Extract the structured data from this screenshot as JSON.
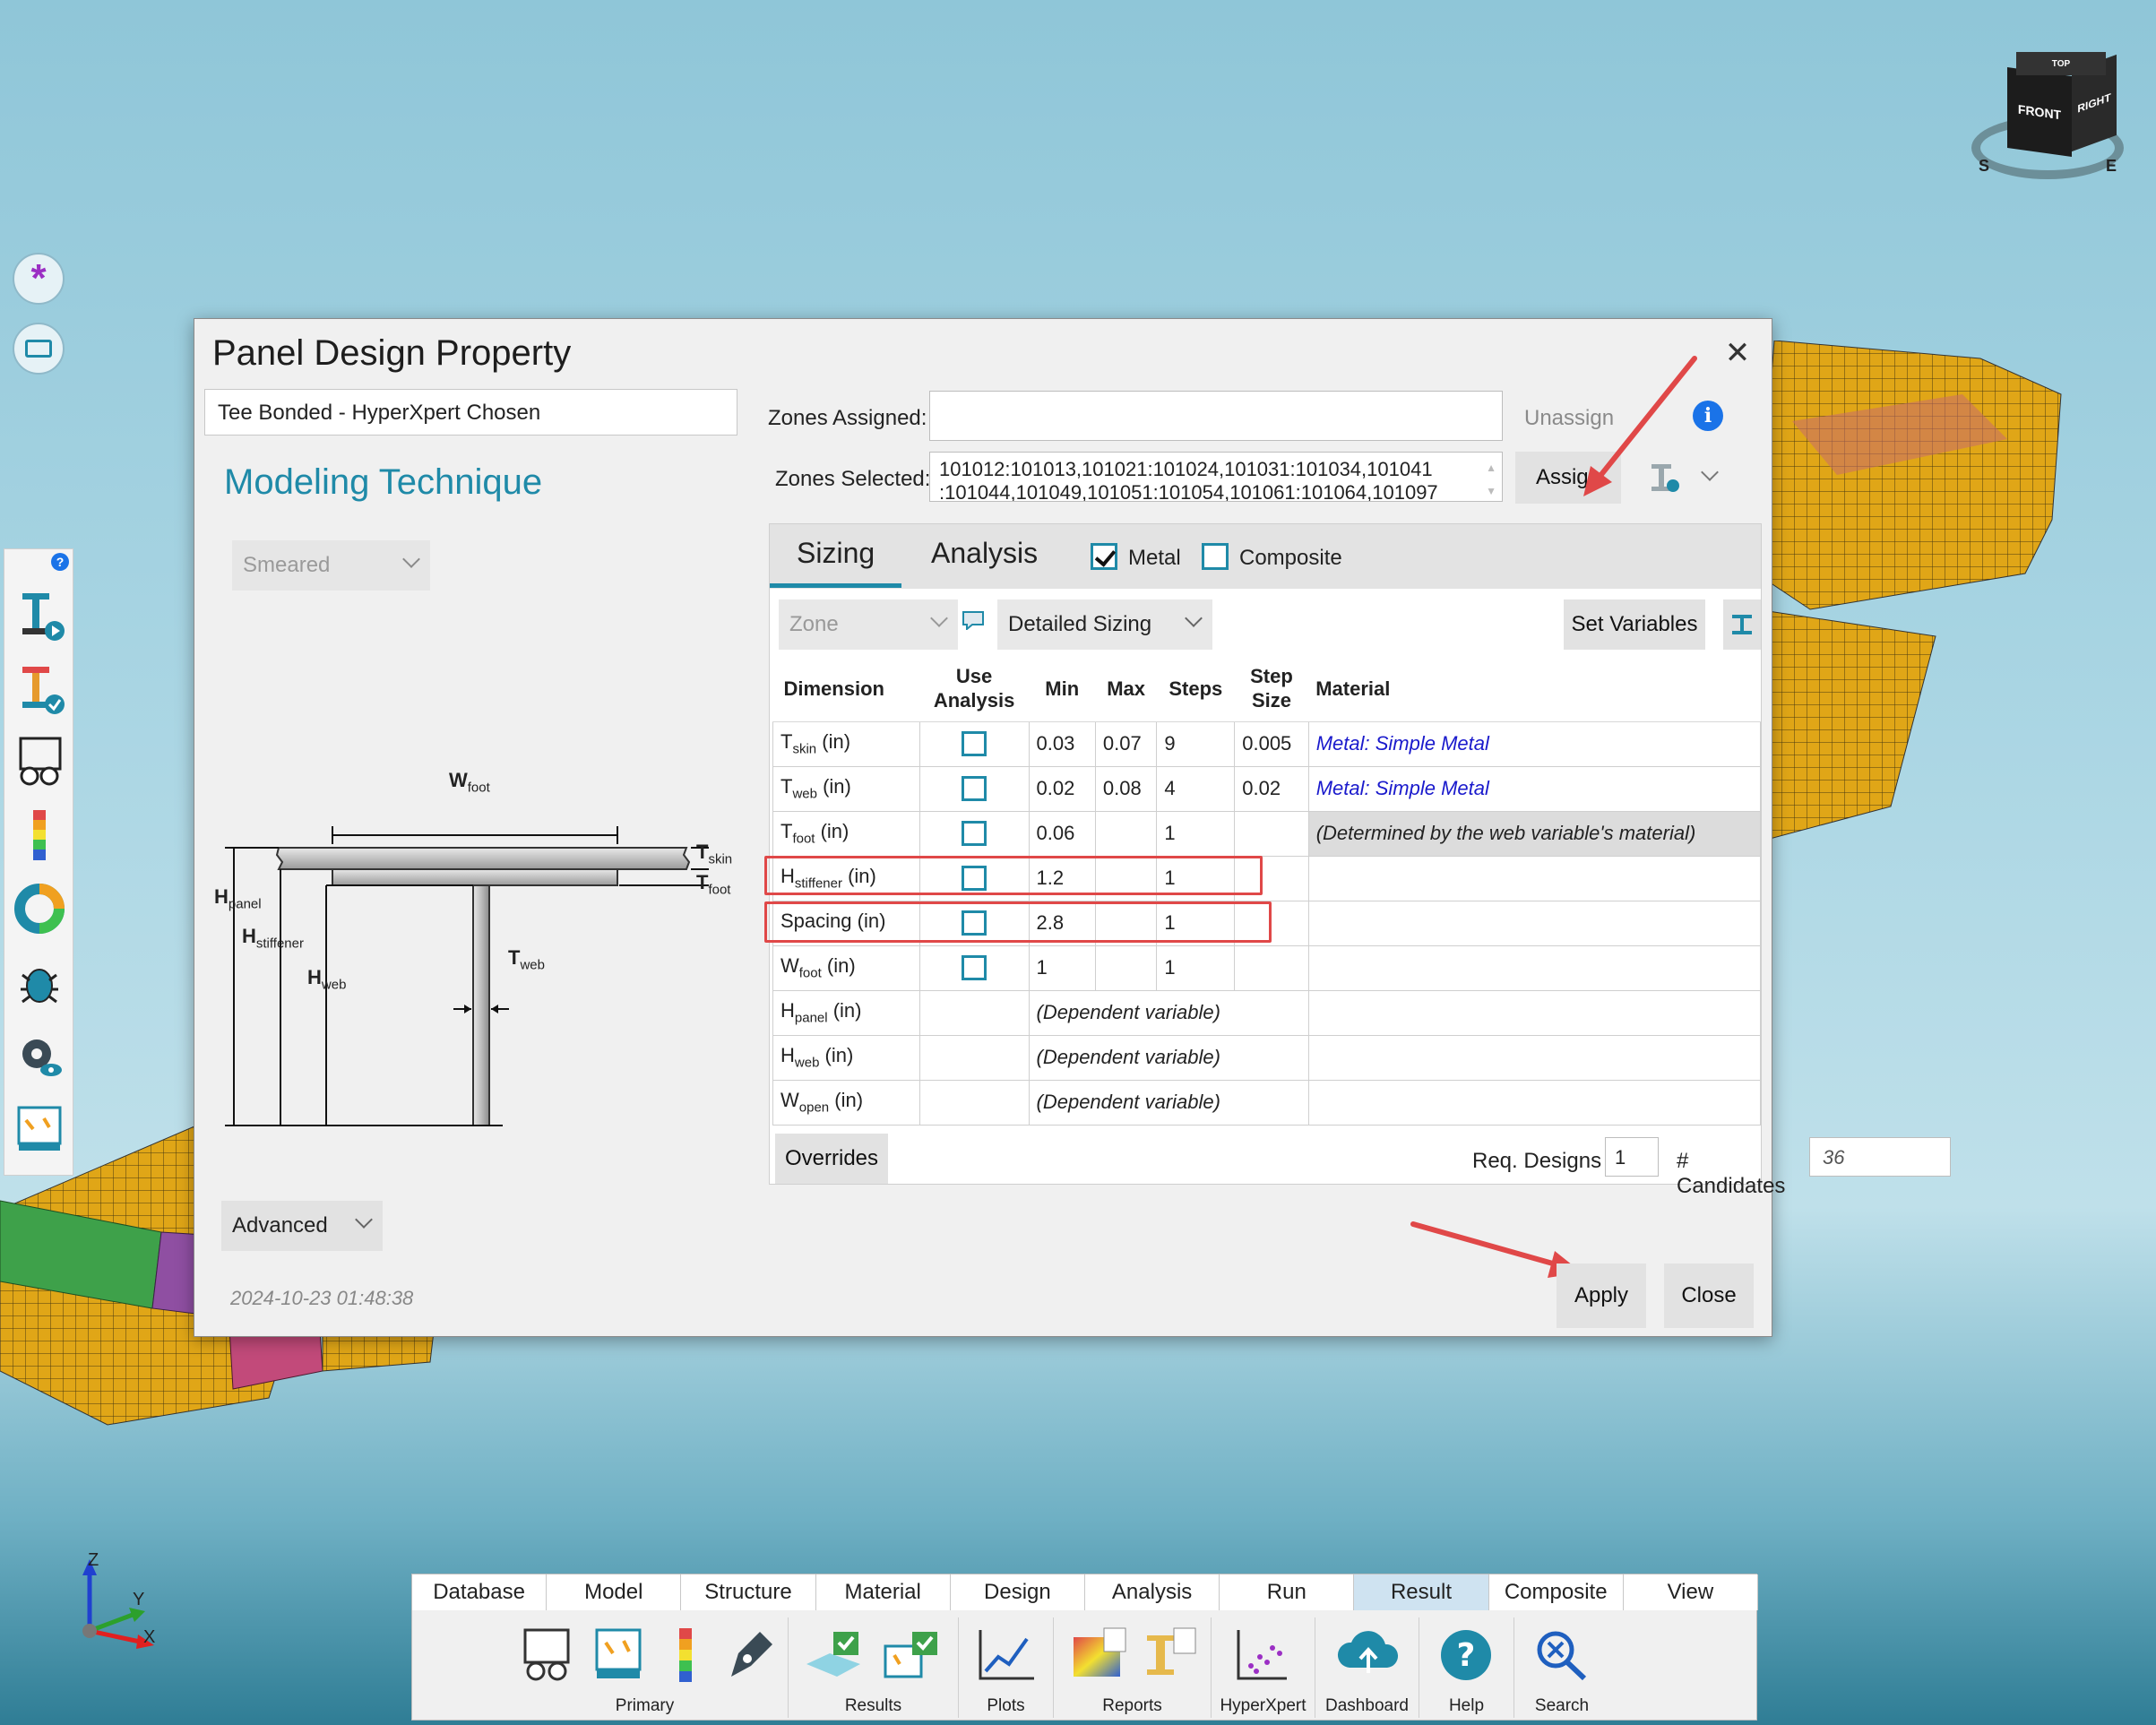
{
  "dialog": {
    "title": "Panel Design Property",
    "chosen_label": "Tee Bonded - HyperXpert Chosen",
    "modeling_title": "Modeling Technique",
    "technique_value": "Smeared",
    "advanced_label": "Advanced",
    "timestamp": "2024-10-23 01:48:38",
    "zones_assigned_label": "Zones Assigned:",
    "zones_assigned_value": "",
    "zones_selected_label": "Zones Selected:",
    "zones_selected_line1": "101012:101013,101021:101024,101031:101034,101041",
    "zones_selected_line2": ":101044,101049,101051:101054,101061:101064,101097",
    "unassign_label": "Unassign",
    "assign_label": "Assign",
    "info_glyph": "i",
    "apply_label": "Apply",
    "close_label": "Close"
  },
  "sizing": {
    "tabs": [
      "Sizing",
      "Analysis"
    ],
    "metal_label": "Metal",
    "metal_checked": true,
    "composite_label": "Composite",
    "composite_checked": false,
    "zone_dropdown": "Zone",
    "mode_dropdown": "Detailed Sizing",
    "set_variables_label": "Set Variables",
    "columns": [
      "Dimension",
      "Use Analysis",
      "Min",
      "Max",
      "Steps",
      "Step Size",
      "Material"
    ],
    "rows": [
      {
        "dim": "T",
        "sub": "skin",
        "unit": " (in)",
        "use": true,
        "min": "0.03",
        "max": "0.07",
        "steps": "9",
        "step_size": "0.005",
        "material": "Metal: Simple Metal"
      },
      {
        "dim": "T",
        "sub": "web",
        "unit": " (in)",
        "use": true,
        "min": "0.02",
        "max": "0.08",
        "steps": "4",
        "step_size": "0.02",
        "material": "Metal: Simple Metal"
      },
      {
        "dim": "T",
        "sub": "foot",
        "unit": " (in)",
        "use": true,
        "min": "0.06",
        "max": "",
        "steps": "1",
        "step_size": "",
        "material": "(Determined by the web variable's material)"
      },
      {
        "dim": "H",
        "sub": "stiffener",
        "unit": " (in)",
        "use": true,
        "min": "1.2",
        "max": "",
        "steps": "1",
        "step_size": "",
        "material": ""
      },
      {
        "dim": "Spacing",
        "sub": "",
        "unit": " (in)",
        "use": true,
        "min": "2.8",
        "max": "",
        "steps": "1",
        "step_size": "",
        "material": ""
      },
      {
        "dim": "W",
        "sub": "foot",
        "unit": " (in)",
        "use": true,
        "min": "1",
        "max": "",
        "steps": "1",
        "step_size": "",
        "material": ""
      },
      {
        "dim": "H",
        "sub": "panel",
        "unit": " (in)",
        "use": false,
        "min": "(Dependent variable)",
        "max": "",
        "steps": "",
        "step_size": "",
        "material": ""
      },
      {
        "dim": "H",
        "sub": "web",
        "unit": " (in)",
        "use": false,
        "min": "(Dependent variable)",
        "max": "",
        "steps": "",
        "step_size": "",
        "material": ""
      },
      {
        "dim": "W",
        "sub": "open",
        "unit": " (in)",
        "use": false,
        "min": "(Dependent variable)",
        "max": "",
        "steps": "",
        "step_size": "",
        "material": ""
      }
    ],
    "overrides_label": "Overrides",
    "req_designs_label": "Req. Designs",
    "req_designs_value": "1",
    "candidates_label": "# Candidates",
    "candidates_value": "36"
  },
  "diagram": {
    "w_foot": "W",
    "w_foot_sub": "foot",
    "t_skin": "T",
    "t_skin_sub": "skin",
    "t_foot": "T",
    "t_foot_sub": "foot",
    "t_web": "T",
    "t_web_sub": "web",
    "h_panel": "H",
    "h_panel_sub": "panel",
    "h_stiffener": "H",
    "h_stiffener_sub": "stiffener",
    "h_web": "H",
    "h_web_sub": "web"
  },
  "viewcube": {
    "front": "FRONT",
    "right": "RIGHT",
    "top": "TOP",
    "compass_s": "S",
    "compass_e": "E"
  },
  "axes": {
    "z": "Z",
    "y": "Y",
    "x": "X"
  },
  "ribbon": {
    "tabs": [
      "Database",
      "Model",
      "Structure",
      "Material",
      "Design",
      "Analysis",
      "Run",
      "Result",
      "Composite",
      "View"
    ],
    "active_tab": "Result",
    "groups": [
      "Primary",
      "Results",
      "Plots",
      "Reports",
      "HyperXpert",
      "Dashboard",
      "Help",
      "Search"
    ]
  },
  "colors": {
    "accent": "#1f8aa8",
    "highlight": "#e04848",
    "material_link": "#1a1acc"
  }
}
